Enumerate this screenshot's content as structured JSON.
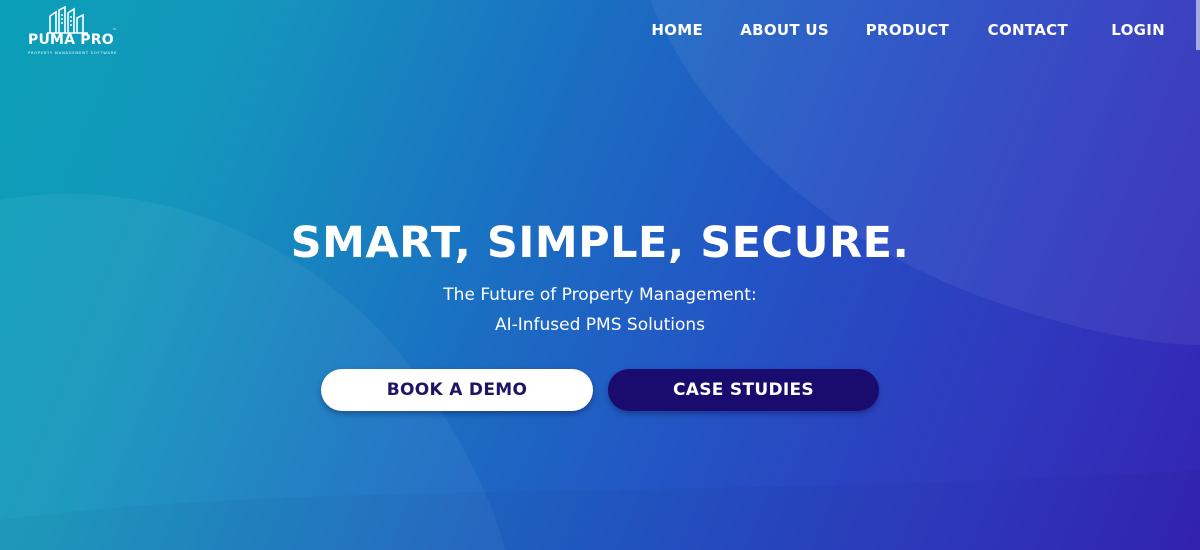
{
  "brand": {
    "name": "PUMA PRO",
    "trademark": "™",
    "tagline": "PROPERTY MANAGEMENT SOFTWARE",
    "logo_icon": "buildings-icon"
  },
  "nav": {
    "items": [
      {
        "label": "HOME"
      },
      {
        "label": "ABOUT US"
      },
      {
        "label": "PRODUCT"
      },
      {
        "label": "CONTACT"
      },
      {
        "label": "LOGIN"
      }
    ]
  },
  "hero": {
    "headline": "SMART, SIMPLE, SECURE.",
    "subtitle_line1": "The Future of Property Management:",
    "subtitle_line2": "AI-Infused PMS Solutions",
    "primary_button": "BOOK A DEMO",
    "secondary_button": "CASE STUDIES"
  },
  "colors": {
    "gradient_start": "#0aa0b8",
    "gradient_end": "#3424b3",
    "primary_button_bg": "#ffffff",
    "primary_button_text": "#1d1466",
    "secondary_button_bg": "#1a0b6e",
    "secondary_button_text": "#ffffff"
  }
}
